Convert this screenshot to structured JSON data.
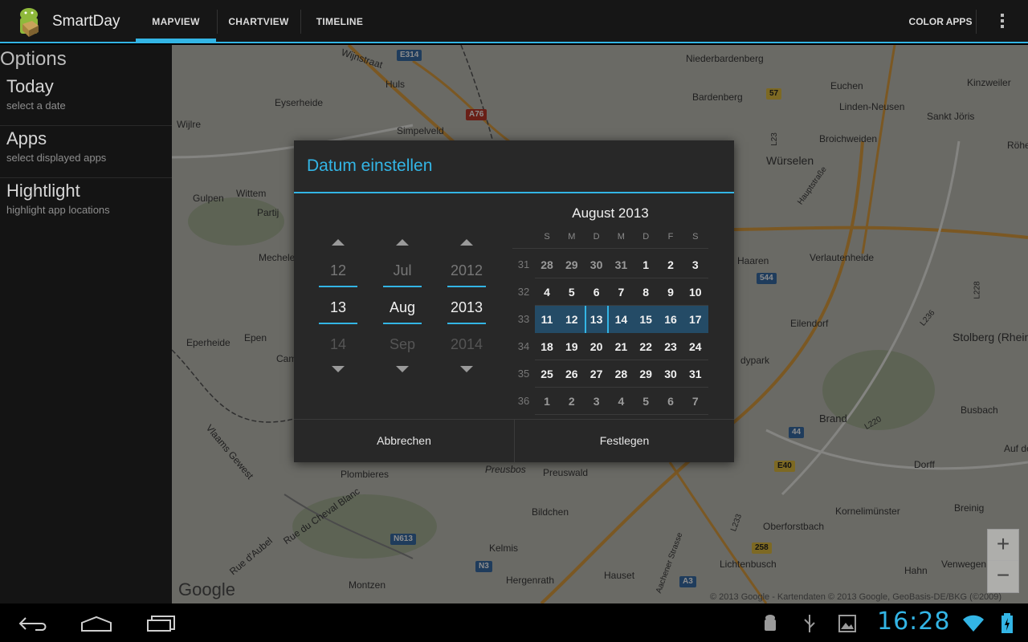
{
  "app": {
    "title": "SmartDay"
  },
  "tabs": [
    {
      "label": "MAPVIEW",
      "active": true
    },
    {
      "label": "CHARTVIEW",
      "active": false
    },
    {
      "label": "TIMELINE",
      "active": false
    }
  ],
  "actions": {
    "color_apps": "COLOR APPS",
    "overflow_icon": "overflow-menu-icon"
  },
  "sidebar": {
    "header": "Options",
    "items": [
      {
        "title": "Today",
        "subtitle": "select a date"
      },
      {
        "title": "Apps",
        "subtitle": "select displayed apps"
      },
      {
        "title": "Hightlight",
        "subtitle": "highlight app locations"
      }
    ]
  },
  "map": {
    "places": [
      "Wijnstraat",
      "Huls",
      "Eyserheide",
      "Wijlre",
      "Simpelveld",
      "Niederbardenberg",
      "Euchen",
      "Kinzweiler",
      "Bardenberg",
      "Linden-Neusen",
      "Sankt Jöris",
      "Broichweiden",
      "Röhe",
      "Würselen",
      "Gulpen",
      "Wittem",
      "Partij",
      "Mechelen",
      "Haaren",
      "Verlautenheide",
      "Eilendorf",
      "Stolberg (Rheinland)",
      "Eperheide",
      "Epen",
      "Brand",
      "Busbach",
      "Auf der",
      "Vlaams Gewest",
      "Plombieres",
      "Preusbos",
      "Preuswald",
      "Bildchen",
      "Dorff",
      "Kornelimünster",
      "Breinig",
      "Oberforstbach",
      "Kelmis",
      "Rue du Cheval Blanc",
      "Rue d'Aubel",
      "Hergenrath",
      "Montzen",
      "Hauset",
      "Lichtenbusch",
      "Hahn",
      "Venwegen",
      "Aachener Strasse",
      "Hauptstraße",
      "Camp",
      "dypark"
    ],
    "shields": [
      "E314",
      "A76",
      "57",
      "544",
      "44",
      "E40",
      "N613",
      "N3",
      "258",
      "A3",
      "L23",
      "L236",
      "L228",
      "L220",
      "L233"
    ],
    "copyright": "© 2013 Google - Kartendaten © 2013 Google, GeoBasis-DE/BKG (©2009)",
    "google_logo": "Google",
    "zoom_in": "+",
    "zoom_out": "−"
  },
  "dialog": {
    "title": "Datum einstellen",
    "spinners": [
      {
        "name": "day",
        "prev": "12",
        "current": "13",
        "next": "14"
      },
      {
        "name": "month",
        "prev": "Jul",
        "current": "Aug",
        "next": "Sep"
      },
      {
        "name": "year",
        "prev": "2012",
        "current": "2013",
        "next": "2014"
      }
    ],
    "calendar": {
      "title": "August 2013",
      "weekdays": [
        "S",
        "M",
        "D",
        "M",
        "D",
        "F",
        "S"
      ],
      "weeks": [
        {
          "number": "31",
          "days": [
            "28",
            "29",
            "30",
            "31",
            "1",
            "2",
            "3"
          ]
        },
        {
          "number": "32",
          "days": [
            "4",
            "5",
            "6",
            "7",
            "8",
            "9",
            "10"
          ]
        },
        {
          "number": "33",
          "days": [
            "11",
            "12",
            "13",
            "14",
            "15",
            "16",
            "17"
          ]
        },
        {
          "number": "34",
          "days": [
            "18",
            "19",
            "20",
            "21",
            "22",
            "23",
            "24"
          ]
        },
        {
          "number": "35",
          "days": [
            "25",
            "26",
            "27",
            "28",
            "29",
            "30",
            "31"
          ]
        },
        {
          "number": "36",
          "days": [
            "1",
            "2",
            "3",
            "4",
            "5",
            "6",
            "7"
          ]
        }
      ],
      "selected_week": "33",
      "selected_day": "13"
    },
    "cancel": "Abbrechen",
    "confirm": "Festlegen"
  },
  "system": {
    "clock": "16:28",
    "nav_icons": [
      "back-icon",
      "home-icon",
      "recent-apps-icon"
    ],
    "status_icons": [
      "android-debug-icon",
      "usb-icon",
      "gallery-icon",
      "wifi-icon",
      "battery-icon"
    ]
  },
  "colors": {
    "accent": "#33b5e5",
    "selected_week": "#244b66"
  }
}
